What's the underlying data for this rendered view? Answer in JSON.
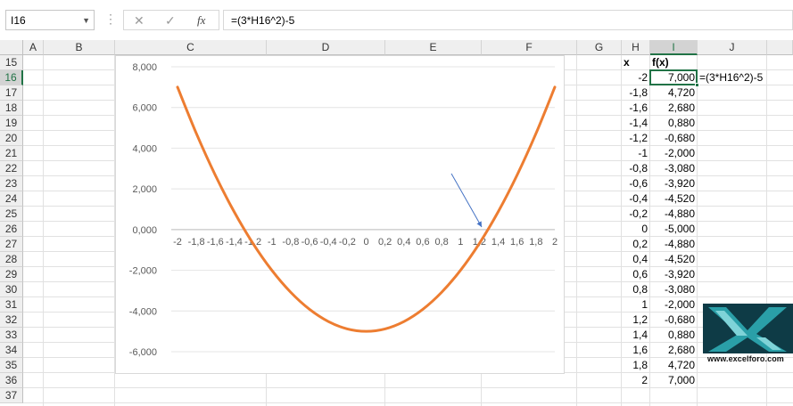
{
  "formula_bar": {
    "name_box": "I16",
    "formula": "=(3*H16^2)-5",
    "cancel_glyph": "✕",
    "enter_glyph": "✓",
    "fx_glyph": "fx",
    "separator_glyph": "⋮",
    "dropdown_glyph": "▼"
  },
  "columns": [
    "A",
    "B",
    "C",
    "D",
    "E",
    "F",
    "G",
    "H",
    "I",
    "J"
  ],
  "selected_column": "I",
  "rows": [
    "15",
    "16",
    "17",
    "18",
    "19",
    "20",
    "21",
    "22",
    "23",
    "24",
    "25",
    "26",
    "27",
    "28",
    "29",
    "30",
    "31",
    "32",
    "33",
    "34",
    "35",
    "36",
    "37"
  ],
  "selected_row": "16",
  "table": {
    "header_x": "x",
    "header_fx": "f(x)",
    "x_values": [
      "-2",
      "-1,8",
      "-1,6",
      "-1,4",
      "-1,2",
      "-1",
      "-0,8",
      "-0,6",
      "-0,4",
      "-0,2",
      "0",
      "0,2",
      "0,4",
      "0,6",
      "0,8",
      "1",
      "1,2",
      "1,4",
      "1,6",
      "1,8",
      "2"
    ],
    "fx_values": [
      "7,000",
      "4,720",
      "2,680",
      "0,880",
      "-0,680",
      "-2,000",
      "-3,080",
      "-3,920",
      "-4,520",
      "-4,880",
      "-5,000",
      "-4,880",
      "-4,520",
      "-3,920",
      "-3,080",
      "-2,000",
      "-0,680",
      "0,880",
      "2,680",
      "4,720",
      "7,000"
    ],
    "formula_note": "=(3*H16^2)-5"
  },
  "chart_data": {
    "type": "line",
    "title": "",
    "xlabel": "",
    "ylabel": "",
    "categories": [
      "-2",
      "-1,8",
      "-1,6",
      "-1,4",
      "-1,2",
      "-1",
      "-0,8",
      "-0,6",
      "-0,4",
      "-0,2",
      "0",
      "0,2",
      "0,4",
      "0,6",
      "0,8",
      "1",
      "1,2",
      "1,4",
      "1,6",
      "1,8",
      "2"
    ],
    "series": [
      {
        "values": [
          7,
          4.72,
          2.68,
          0.88,
          -0.68,
          -2,
          -3.08,
          -3.92,
          -4.52,
          -4.88,
          -5,
          -4.88,
          -4.52,
          -3.92,
          -3.08,
          -2,
          -0.68,
          0.88,
          2.68,
          4.72,
          7
        ]
      }
    ],
    "ylim": [
      -6,
      8
    ],
    "yticks": [
      8,
      6,
      4,
      2,
      0,
      -2,
      -4,
      -6
    ],
    "ytick_labels": [
      "8,000",
      "6,000",
      "4,000",
      "2,000",
      "0,000",
      "-2,000",
      "-4,000",
      "-6,000"
    ],
    "grid": true,
    "legend": "none",
    "line_color": "#ED7D31",
    "annotation": "arrow pointing to root near x = 1,3"
  },
  "logo": {
    "text": "www.excelforo.com",
    "colors": {
      "teal": "#2A9FA8",
      "dark": "#0E3B46"
    }
  },
  "colors": {
    "accent": "#217346",
    "grid": "#E1E1E1",
    "header_bg": "#EFEFEF"
  }
}
